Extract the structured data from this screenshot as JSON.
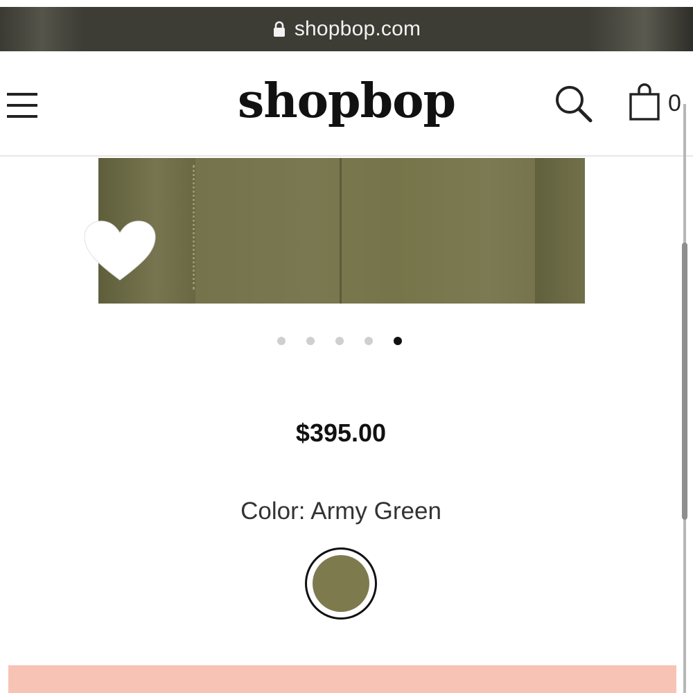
{
  "browser": {
    "url": "shopbop.com"
  },
  "header": {
    "logo": "shopbop",
    "bag_count": "0"
  },
  "product": {
    "price": "$395.00",
    "color_label": "Color: Army Green",
    "carousel": {
      "total_slides": 5,
      "active_index": 4
    },
    "swatch_color": "#7d7a4e"
  },
  "colors": {
    "add_to_bag_bar": "#f7c3b5",
    "scrollbar": "#8e8e8e"
  },
  "icons": {
    "menu": "hamburger-icon",
    "search": "search-icon",
    "bag": "shopping-bag-icon",
    "wishlist": "heart-icon",
    "lock": "lock-icon"
  }
}
